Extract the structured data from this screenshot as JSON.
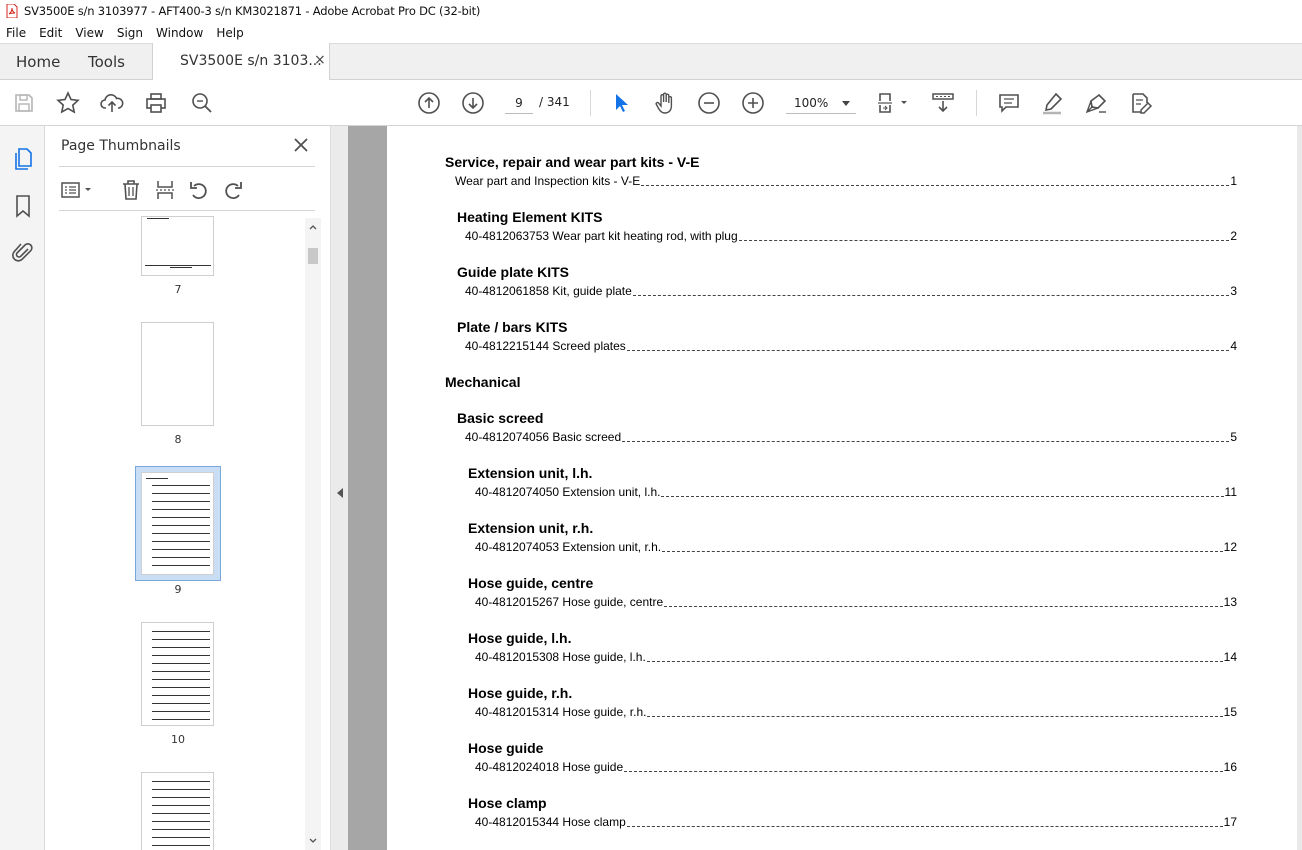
{
  "window": {
    "title": "SV3500E s/n 3103977 - AFT400-3 s/n KM3021871 - Adobe Acrobat Pro DC (32-bit)"
  },
  "menu": [
    "File",
    "Edit",
    "View",
    "Sign",
    "Window",
    "Help"
  ],
  "tabs": {
    "home": "Home",
    "tools": "Tools",
    "document": "SV3500E s/n 3103...",
    "close": "×"
  },
  "toolbar": {
    "current_page": "9",
    "page_total": "/ 341",
    "zoom": "100%"
  },
  "panel": {
    "title": "Page Thumbnails"
  },
  "thumbnails": [
    {
      "label": "7"
    },
    {
      "label": "8"
    },
    {
      "label": "9",
      "selected": true
    },
    {
      "label": "10"
    },
    {
      "label": ""
    }
  ],
  "toc": [
    {
      "type": "head",
      "text": "Service, repair and wear part kits - V-E"
    },
    {
      "type": "line",
      "text": "Wear part and Inspection kits - V-E",
      "page": "1"
    },
    {
      "type": "head",
      "text": "Heating Element KITS"
    },
    {
      "type": "line",
      "text": "40-4812063753 Wear part kit heating rod, with plug",
      "page": "2"
    },
    {
      "type": "head",
      "text": "Guide plate KITS"
    },
    {
      "type": "line",
      "text": "40-4812061858 Kit, guide plate",
      "page": "3"
    },
    {
      "type": "head",
      "text": "Plate / bars KITS"
    },
    {
      "type": "line",
      "text": "40-4812215144 Screed plates",
      "page": "4"
    },
    {
      "type": "head",
      "text": "Mechanical"
    },
    {
      "type": "head",
      "text": "Basic screed"
    },
    {
      "type": "line",
      "text": "40-4812074056 Basic screed",
      "page": "5"
    },
    {
      "type": "head",
      "text": "Extension unit, l.h."
    },
    {
      "type": "line",
      "text": "40-4812074050 Extension unit, l.h.",
      "page": "11"
    },
    {
      "type": "head",
      "text": "Extension unit, r.h."
    },
    {
      "type": "line",
      "text": "40-4812074053 Extension unit, r.h.",
      "page": "12"
    },
    {
      "type": "head",
      "text": "Hose guide, centre"
    },
    {
      "type": "line",
      "text": "40-4812015267 Hose guide, centre",
      "page": "13"
    },
    {
      "type": "head",
      "text": "Hose guide, l.h."
    },
    {
      "type": "line",
      "text": "40-4812015308 Hose guide, l.h.",
      "page": "14"
    },
    {
      "type": "head",
      "text": "Hose guide, r.h."
    },
    {
      "type": "line",
      "text": "40-4812015314 Hose guide, r.h.",
      "page": "15"
    },
    {
      "type": "head",
      "text": "Hose guide"
    },
    {
      "type": "line",
      "text": "40-4812024018 Hose guide",
      "page": "16"
    },
    {
      "type": "head",
      "text": "Hose clamp"
    },
    {
      "type": "line",
      "text": "40-4812015344 Hose clamp",
      "page": "17"
    }
  ],
  "colors": {
    "accent": "#1473e6",
    "icon": "#505050",
    "app_red": "#d4251c"
  },
  "icons": [
    "pdf-app-icon",
    "save-icon",
    "bookmark-star-icon",
    "upload-icon",
    "print-icon",
    "search-zoom-icon",
    "previous-page-icon",
    "next-page-icon",
    "select-arrow-icon",
    "hand-icon",
    "zoom-out-icon",
    "zoom-in-icon",
    "fit-page-icon",
    "scroll-mode-icon",
    "comment-icon",
    "highlight-icon",
    "sign-icon",
    "edit-pdf-icon",
    "page-thumbnails-icon",
    "bookmarks-icon",
    "attachments-icon",
    "options-icon",
    "delete-icon",
    "insert-page-icon",
    "rotate-ccw-icon",
    "rotate-cw-icon",
    "close-icon",
    "collapse-panel-icon"
  ]
}
